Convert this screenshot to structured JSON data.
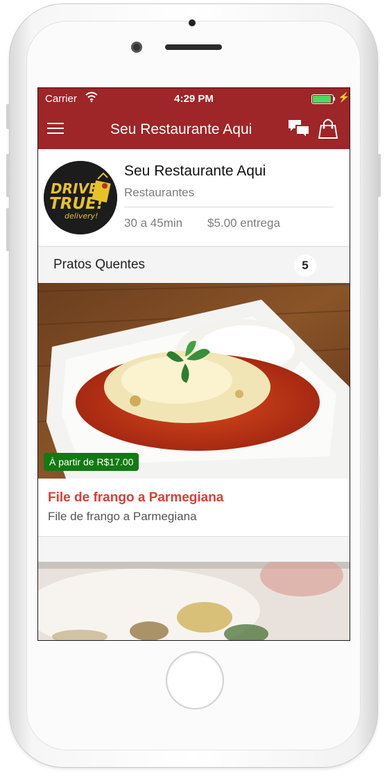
{
  "status_bar": {
    "carrier": "Carrier",
    "time": "4:29 PM"
  },
  "nav": {
    "title": "Seu Restaurante Aqui"
  },
  "restaurant": {
    "name": "Seu Restaurante Aqui",
    "category": "Restaurantes",
    "delivery_time": "30 a 45min",
    "delivery_fee": "$5.00 entrega",
    "logo": {
      "line1": "DRIVE",
      "line2": "TRUE!",
      "line3": "delivery!"
    }
  },
  "section": {
    "title": "Pratos Quentes",
    "count": "5"
  },
  "items": [
    {
      "price": "À partir de R$17.00",
      "title": "File de frango a Parmegiana",
      "description": "File de frango a Parmegiana"
    }
  ],
  "colors": {
    "brand": "#9e2528",
    "price_badge": "#127a12",
    "item_title": "#dd3e34"
  },
  "icons": [
    "menu-icon",
    "chat-icon",
    "shopping-bag-icon",
    "wifi-icon",
    "battery-icon"
  ]
}
